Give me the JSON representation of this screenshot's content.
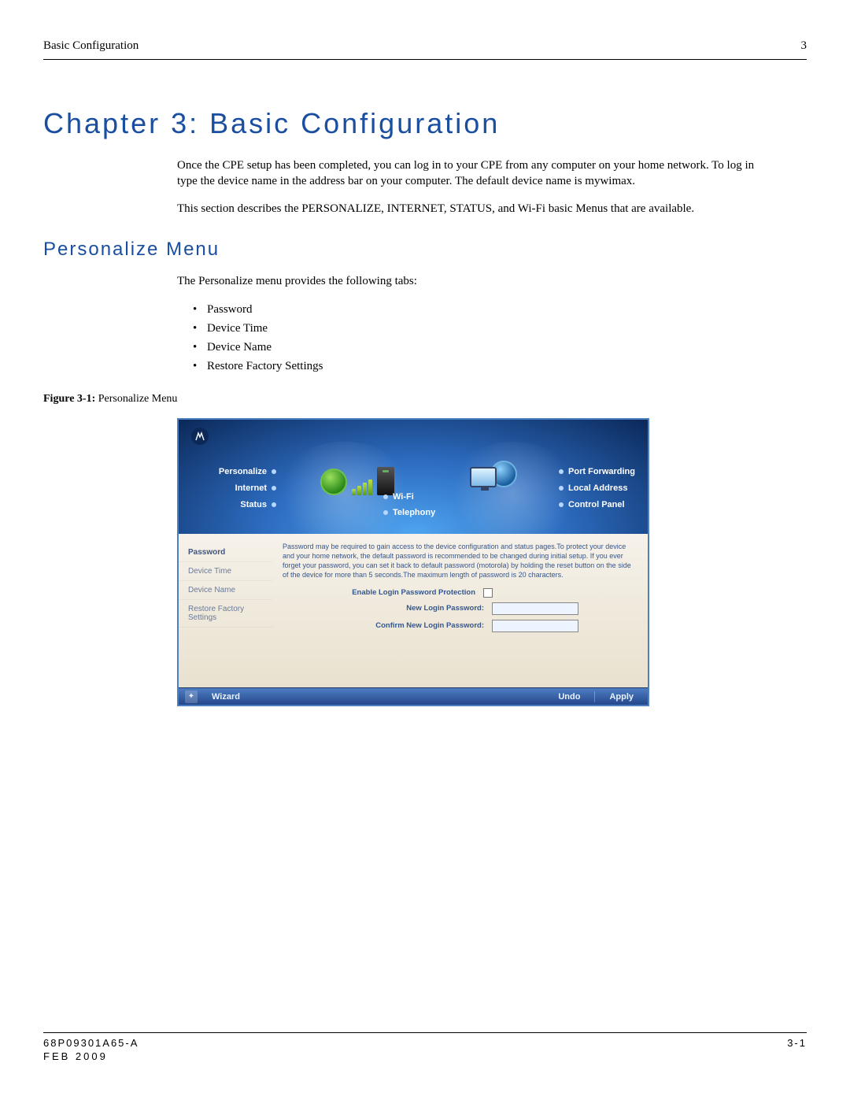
{
  "header": {
    "left": "Basic Configuration",
    "right": "3"
  },
  "chapter_title": "Chapter 3: Basic Configuration",
  "intro_p1": "Once the CPE setup has been completed, you can log in to your CPE from any computer on your home network. To log in type the device name in the address bar on your computer. The default device name is mywimax.",
  "intro_p2": "This section describes the PERSONALIZE, INTERNET, STATUS, and Wi-Fi basic Menus that are available.",
  "section_title": "Personalize Menu",
  "section_intro": "The Personalize menu provides the following tabs:",
  "tabs_list": [
    "Password",
    "Device Time",
    "Device Name",
    "Restore Factory Settings"
  ],
  "figure": {
    "label": "Figure 3-1:",
    "caption": "Personalize Menu"
  },
  "ui": {
    "nav_left": {
      "personalize": "Personalize",
      "internet": "Internet",
      "status": "Status"
    },
    "nav_mid": {
      "wifi": "Wi-Fi",
      "telephony": "Telephony"
    },
    "nav_right": {
      "portfwd": "Port Forwarding",
      "localaddr": "Local Address",
      "cpanel": "Control Panel"
    },
    "side": {
      "password": "Password",
      "device_time": "Device Time",
      "device_name": "Device Name",
      "restore": "Restore Factory Settings"
    },
    "help_text": "Password may be required to gain access to the device configuration and status pages.To protect your device and your home network, the default password is recommended to be changed during initial setup. If you ever forget your password, you can set it back to default password (motorola) by holding the reset button on the side of the device for more than 5 seconds.The maximum length of password is 20 characters.",
    "form": {
      "enable_label": "Enable Login Password Protection",
      "new_pw_label": "New Login Password:",
      "confirm_pw_label": "Confirm New Login Password:"
    },
    "footer": {
      "wizard": "Wizard",
      "undo": "Undo",
      "apply": "Apply"
    }
  },
  "page_footer": {
    "docnum": "68P09301A65-A",
    "date": "FEB 2009",
    "pagenum": "3-1"
  }
}
